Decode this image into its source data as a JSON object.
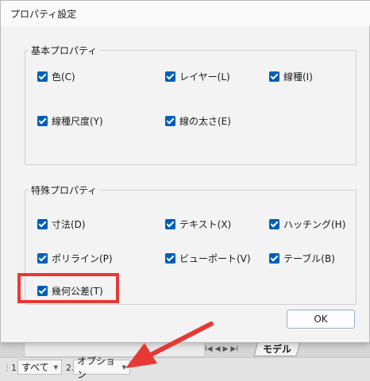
{
  "dialog": {
    "title": "プロパティ設定",
    "ok_label": "OK",
    "basic_group": {
      "label": "基本プロパティ",
      "items": [
        {
          "label": "色(C)",
          "checked": true
        },
        {
          "label": "レイヤー(L)",
          "checked": true
        },
        {
          "label": "線種(I)",
          "checked": true
        },
        {
          "label": "線種尺度(Y)",
          "checked": true
        },
        {
          "label": "線の太さ(E)",
          "checked": true
        }
      ]
    },
    "special_group": {
      "label": "特殊プロパティ",
      "items": [
        {
          "label": "寸法(D)",
          "checked": true
        },
        {
          "label": "テキスト(X)",
          "checked": true
        },
        {
          "label": "ハッチング(H)",
          "checked": true
        },
        {
          "label": "ポリライン(P)",
          "checked": true
        },
        {
          "label": "ビューポート(V)",
          "checked": true
        },
        {
          "label": "テーブル(B)",
          "checked": true
        },
        {
          "label": "幾何公差(T)",
          "checked": true
        }
      ]
    }
  },
  "background_app": {
    "layout_nav_glyphs": [
      "I◀",
      "◀",
      "▶",
      "▶I"
    ],
    "model_tab_label": "モデル",
    "statusbar": {
      "grip": "⋮",
      "field1_index": "1.",
      "field1_value": "すべて",
      "field2_index": "2.",
      "field2_value": "オプション",
      "dropdown_arrow": "▼"
    }
  },
  "colors": {
    "checkbox_accent": "#005fb8",
    "highlight_red": "#e53935"
  }
}
